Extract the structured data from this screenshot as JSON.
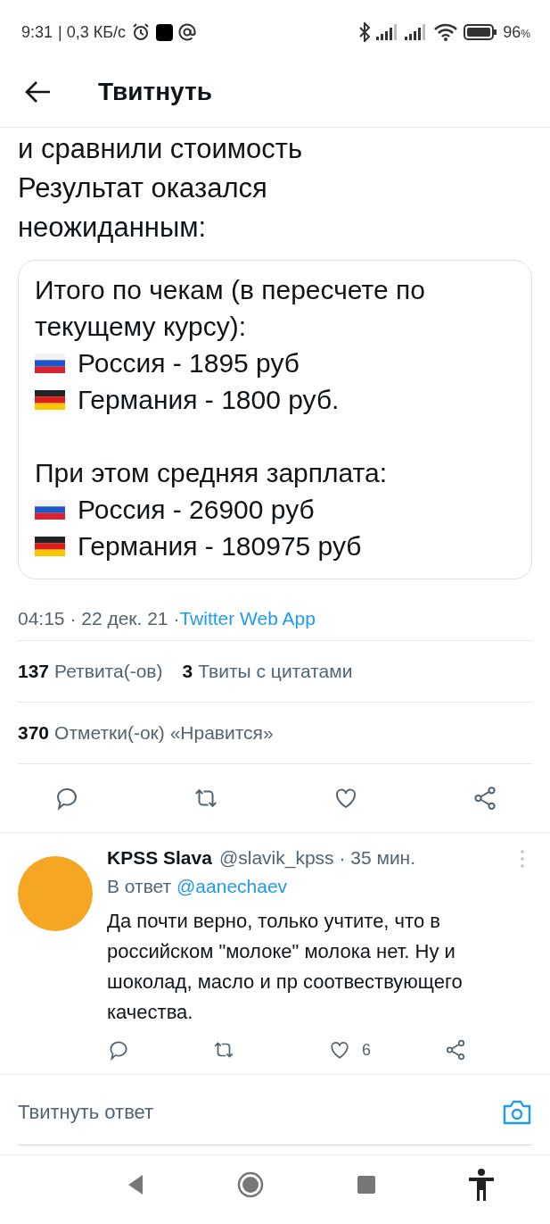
{
  "status_bar": {
    "time": "9:31",
    "speed": "| 0,3 КБ/с",
    "battery": "96",
    "battery_unit": "%"
  },
  "header": {
    "title": "Твитнуть"
  },
  "tweet": {
    "text_lines": [
      "и сравнили стоимость",
      "Результат оказался",
      "неожиданным:"
    ],
    "card": {
      "paragraphs": [
        {
          "lines": [
            {
              "kind": "plain",
              "text": "Итого по чекам (в пересчете по"
            },
            {
              "kind": "plain",
              "text": "текущему курсу):"
            },
            {
              "kind": "russia",
              "text": "Россия - 1895 руб"
            },
            {
              "kind": "germany",
              "text": "Германия - 1800 руб."
            }
          ]
        },
        {
          "lines": [
            {
              "kind": "plain",
              "text": "При этом средняя зарплата:"
            },
            {
              "kind": "russia",
              "text": "Россия - 26900 руб"
            },
            {
              "kind": "germany",
              "text": "Германия - 180975 руб"
            }
          ]
        }
      ]
    },
    "meta": "04:15 · 22 дек. 21 · ",
    "source": "Twitter Web App",
    "stats": [
      {
        "count": "137",
        "label": "Ретвита(-ов)"
      },
      {
        "count": "3",
        "label": "Твиты с цитатами"
      }
    ],
    "likes": {
      "count": "370",
      "label": "Отметки(-ок) «Нравится»"
    }
  },
  "reply": {
    "name": "KPSS Slava",
    "handle": "@slavik_kpss · 35 мин.",
    "reply_prefix": "В ответ",
    "reply_to": "@aanechaev",
    "text": "Да почти верно, только учтите, что в российском \"молоке\" молока нет. Ну и шоколад, масло и пр соотвествующего качества.",
    "like_count": "6"
  },
  "compose": {
    "placeholder": "Твитнуть ответ"
  }
}
